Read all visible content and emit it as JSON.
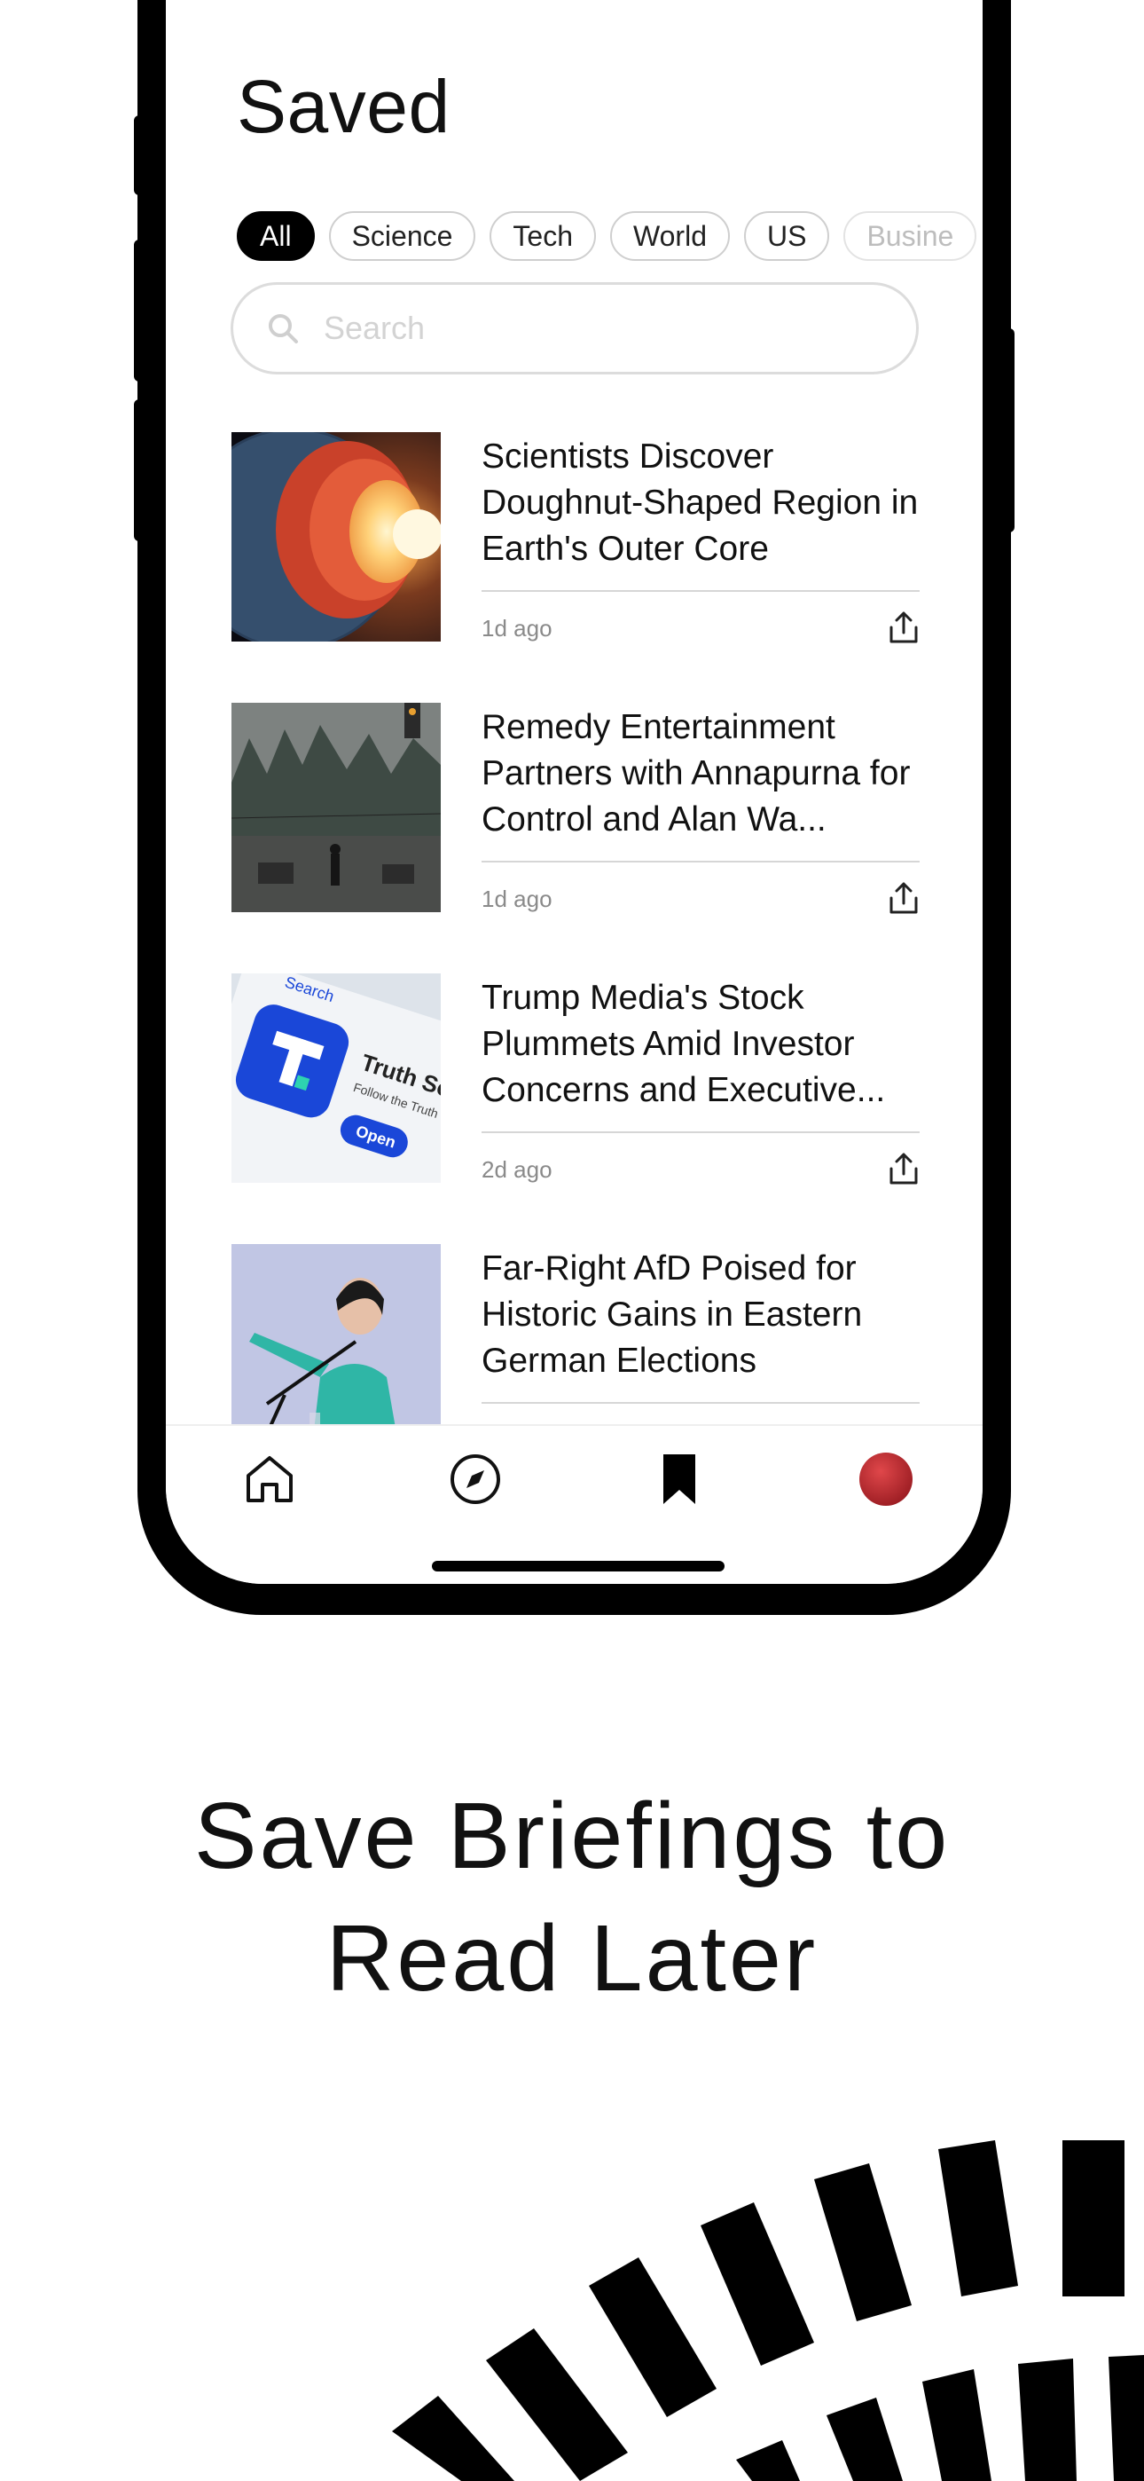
{
  "screen": {
    "title": "Saved",
    "filters": [
      {
        "label": "All",
        "active": true
      },
      {
        "label": "Science",
        "active": false
      },
      {
        "label": "Tech",
        "active": false
      },
      {
        "label": "World",
        "active": false
      },
      {
        "label": "US",
        "active": false
      },
      {
        "label": "Busine",
        "active": false
      }
    ],
    "search": {
      "placeholder": "Search",
      "value": ""
    },
    "articles": [
      {
        "headline": "Scientists Discover Doughnut-Shaped Region in Earth's Outer Core",
        "time": "1d ago"
      },
      {
        "headline": "Remedy Entertainment Partners with Annapurna for Control and Alan Wa...",
        "time": "1d ago"
      },
      {
        "headline": "Trump Media's Stock Plummets Amid Investor Concerns and Executive...",
        "time": "2d ago"
      },
      {
        "headline": "Far-Right AfD Poised for Historic Gains in Eastern German Elections",
        "time": ""
      }
    ],
    "thumbnail_text": {
      "search": "Search",
      "brand": "Truth Soc",
      "tagline": "Follow the Truth",
      "button": "Open"
    },
    "tabbar": {
      "tabs": [
        {
          "icon": "home-icon",
          "selected": false
        },
        {
          "icon": "compass-icon",
          "selected": false
        },
        {
          "icon": "bookmark-icon",
          "selected": true
        },
        {
          "icon": "avatar",
          "selected": false
        }
      ]
    }
  },
  "promo": {
    "line1": "Save Briefings to",
    "line2": "Read Later"
  },
  "colors": {
    "accent": "#000000",
    "avatar": "#c0282d",
    "muted": "#8a8a8a"
  }
}
